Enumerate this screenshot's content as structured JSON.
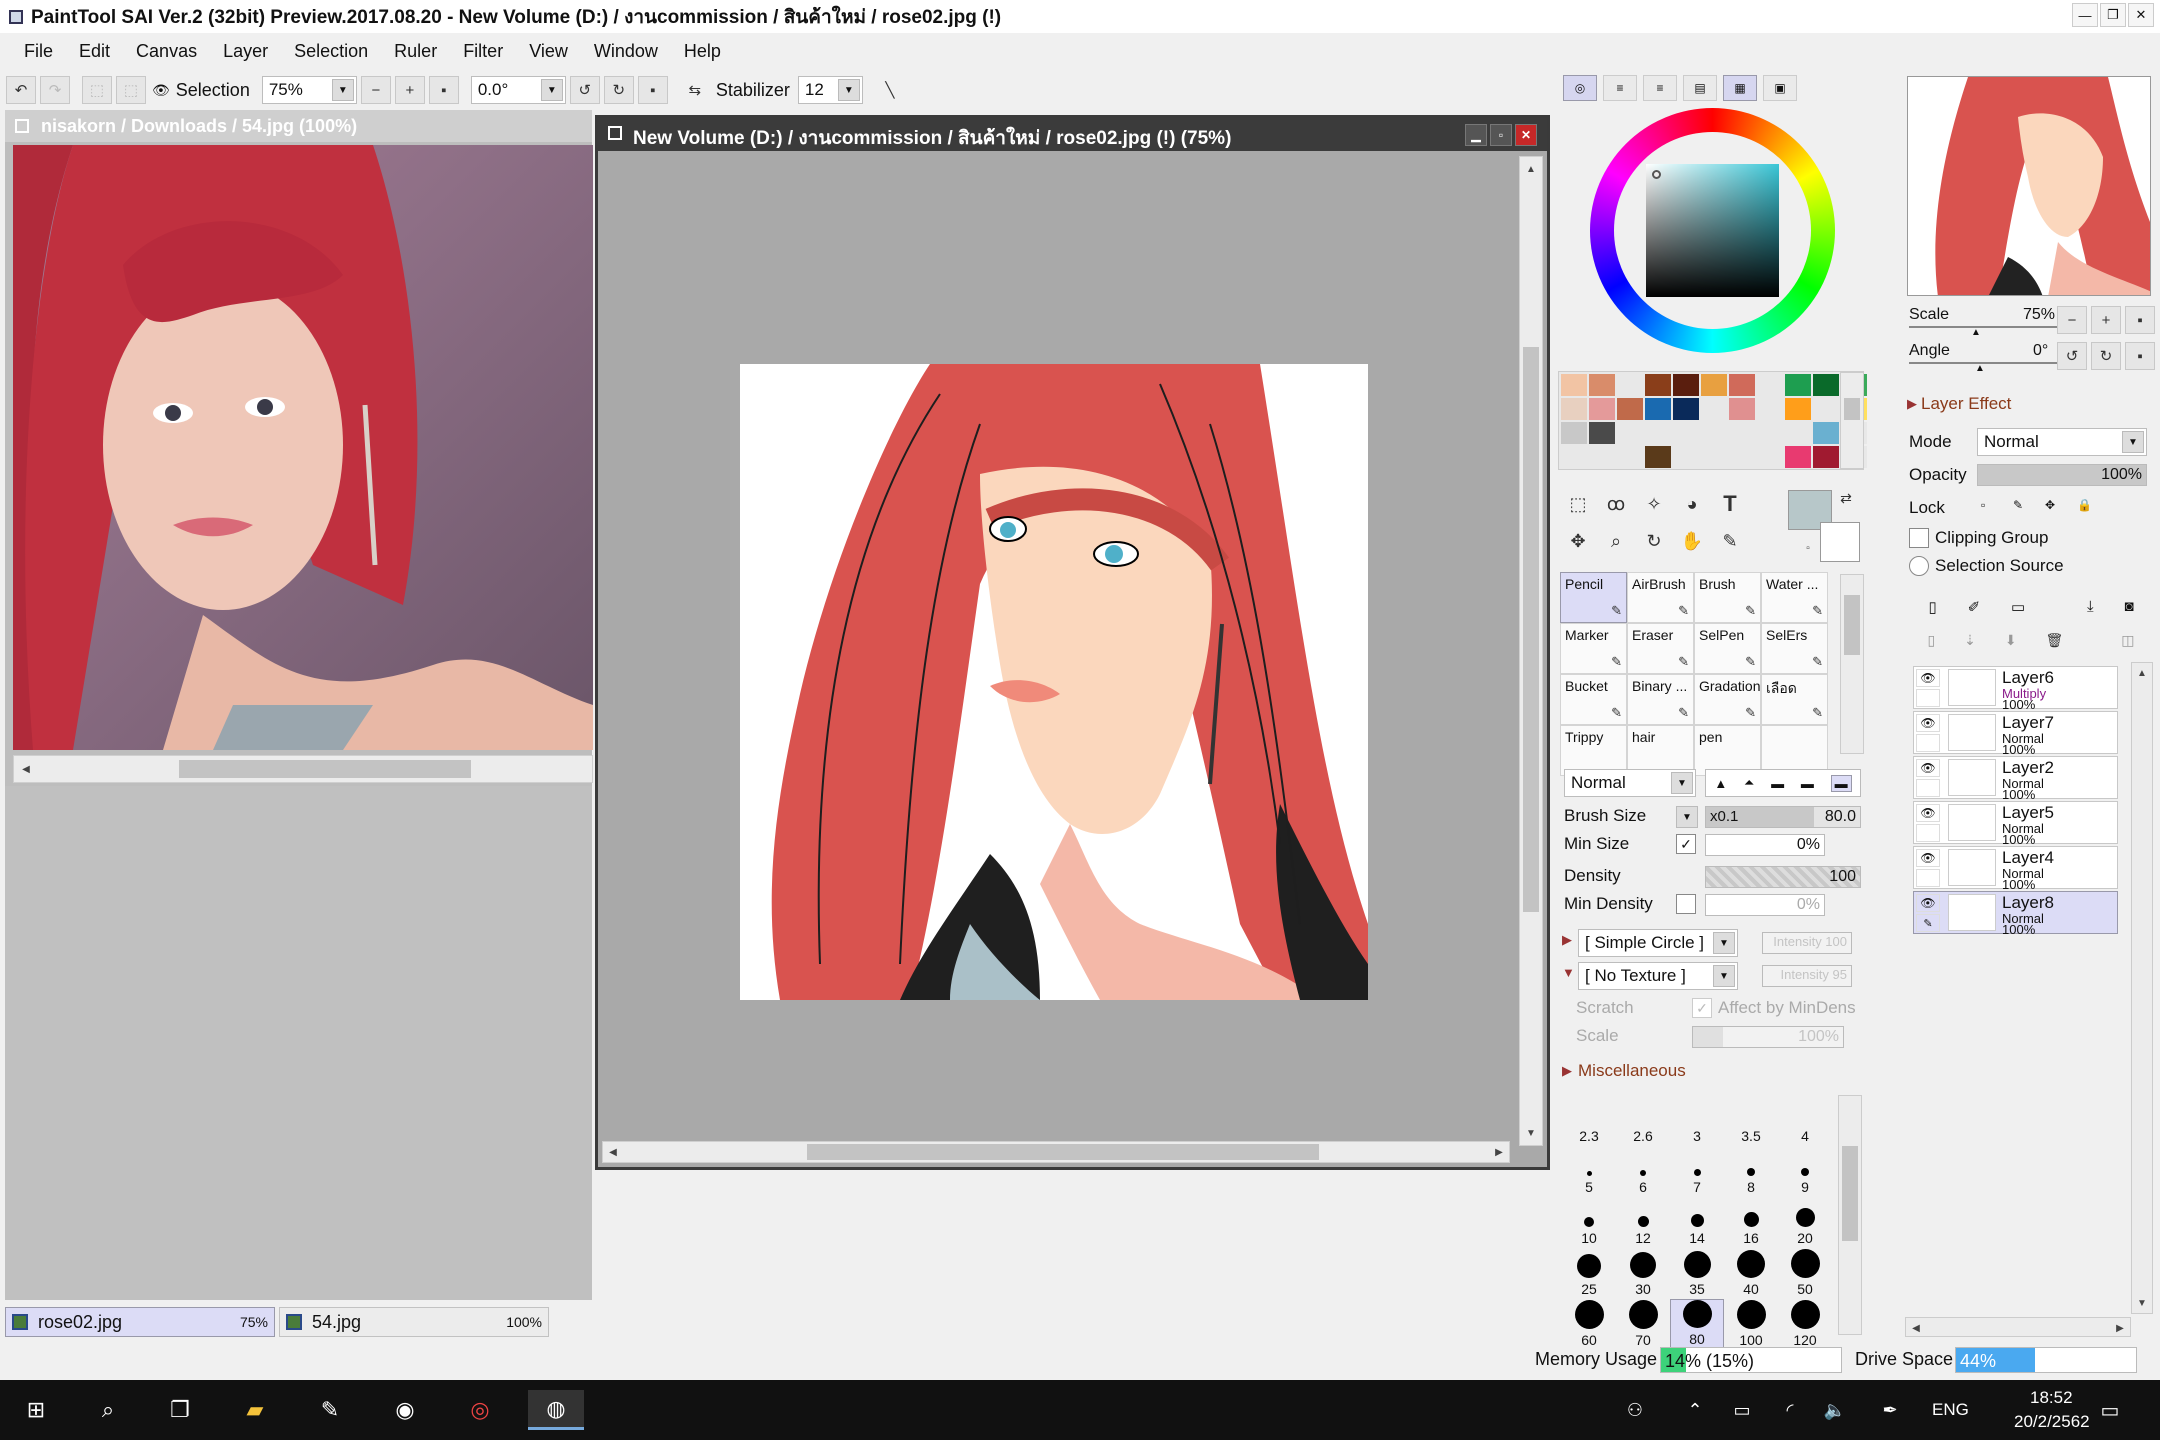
{
  "title_bar": {
    "title": "PaintTool SAI Ver.2 (32bit) Preview.2017.08.20 - New Volume (D:) / งานcommission / สินค้าใหม่ / rose02.jpg (!)"
  },
  "menu": [
    "File",
    "Edit",
    "Canvas",
    "Layer",
    "Selection",
    "Ruler",
    "Filter",
    "View",
    "Window",
    "Help"
  ],
  "toolbar": {
    "selection_label": "Selection",
    "zoom": "75%",
    "rotation": "0.0°",
    "stabilizer_label": "Stabilizer",
    "stabilizer_value": "12"
  },
  "ref_window": {
    "title": "nisakorn / Downloads / 54.jpg (100%)"
  },
  "canvas_window": {
    "title": "New Volume (D:) / งานcommission / สินค้าใหม่ / rose02.jpg (!) (75%)"
  },
  "file_tabs": [
    {
      "name": "rose02.jpg",
      "zoom": "75%",
      "selected": true
    },
    {
      "name": "54.jpg",
      "zoom": "100%",
      "selected": false
    }
  ],
  "swatch_colors": [
    "#f2c4a4",
    "#d98c6a",
    "#e8e8e8",
    "#8a3e1a",
    "#5a1e0e",
    "#e8a040",
    "#d06a5a",
    "#e8e8e8",
    "#1e9e50",
    "#0a6a2a",
    "#3aaa5a",
    "#e8d0c0",
    "#e49a9a",
    "#c06a4a",
    "#1a6ab0",
    "#0a2a5a",
    "#e8e8e8",
    "#e09090",
    "#e8e8e8",
    "#ff9e1a",
    "#e8e8e8",
    "#ffe060",
    "#c8c8c8",
    "#4a4a4a",
    "#e8e8e8",
    "#e8e8e8",
    "#e8e8e8",
    "#e8e8e8",
    "#e8e8e8",
    "#e8e8e8",
    "#e8e8e8",
    "#6ab0d0",
    "#e8e8e8",
    "#e8e8e8",
    "#e8e8e8",
    "#e8e8e8",
    "#5a3a1a",
    "#e8e8e8",
    "#e8e8e8",
    "#e8e8e8",
    "#e8e8e8",
    "#e83a70",
    "#a01a30",
    "#e8e8e8"
  ],
  "brush_tools": [
    {
      "name": "Pencil",
      "selected": true
    },
    {
      "name": "AirBrush"
    },
    {
      "name": "Brush"
    },
    {
      "name": "Water ..."
    },
    {
      "name": "Marker"
    },
    {
      "name": "Eraser"
    },
    {
      "name": "SelPen"
    },
    {
      "name": "SelErs"
    },
    {
      "name": "Bucket"
    },
    {
      "name": "Binary ..."
    },
    {
      "name": "Gradation"
    },
    {
      "name": "เลือด"
    },
    {
      "name": "Trippy"
    },
    {
      "name": "hair"
    },
    {
      "name": "pen"
    },
    {
      "name": ""
    }
  ],
  "brush": {
    "blend_mode": "Normal",
    "brush_size_label": "Brush Size",
    "brush_size_mult": "x0.1",
    "brush_size": "80.0",
    "min_size_label": "Min Size",
    "min_size": "0%",
    "density_label": "Density",
    "density": "100",
    "min_density_label": "Min Density",
    "min_density": "0%",
    "shape": "[ Simple Circle ]",
    "shape_intensity": "Intensity 100",
    "texture": "[ No Texture ]",
    "texture_intensity": "Intensity  95",
    "scratch_label": "Scratch",
    "affect_label": "Affect by MinDens",
    "scale_label": "Scale",
    "scale_value": "100%",
    "misc_label": "Miscellaneous"
  },
  "brush_sizes": [
    {
      "label": "2.3",
      "d": 0
    },
    {
      "label": "2.6",
      "d": 0
    },
    {
      "label": "3",
      "d": 0
    },
    {
      "label": "3.5",
      "d": 0
    },
    {
      "label": "4",
      "d": 0
    },
    {
      "label": "5",
      "d": 5
    },
    {
      "label": "6",
      "d": 6
    },
    {
      "label": "7",
      "d": 7
    },
    {
      "label": "8",
      "d": 8
    },
    {
      "label": "9",
      "d": 8
    },
    {
      "label": "10",
      "d": 10
    },
    {
      "label": "12",
      "d": 11
    },
    {
      "label": "14",
      "d": 13
    },
    {
      "label": "16",
      "d": 15
    },
    {
      "label": "20",
      "d": 19
    },
    {
      "label": "25",
      "d": 24
    },
    {
      "label": "30",
      "d": 26
    },
    {
      "label": "35",
      "d": 27
    },
    {
      "label": "40",
      "d": 28
    },
    {
      "label": "50",
      "d": 29
    },
    {
      "label": "60",
      "d": 29
    },
    {
      "label": "70",
      "d": 29
    },
    {
      "label": "80",
      "d": 29,
      "selected": true
    },
    {
      "label": "100",
      "d": 29
    },
    {
      "label": "120",
      "d": 29
    }
  ],
  "navigator": {
    "scale_label": "Scale",
    "scale": "75%",
    "angle_label": "Angle",
    "angle": "0°"
  },
  "layer_effect": {
    "title": "Layer Effect",
    "mode_label": "Mode",
    "mode": "Normal",
    "opacity_label": "Opacity",
    "opacity": "100%",
    "lock_label": "Lock",
    "clipping_group": "Clipping Group",
    "selection_source": "Selection Source"
  },
  "layers": [
    {
      "name": "Layer6",
      "mode": "Multiply",
      "opacity": "100%"
    },
    {
      "name": "Layer7",
      "mode": "Normal",
      "opacity": "100%"
    },
    {
      "name": "Layer2",
      "mode": "Normal",
      "opacity": "100%"
    },
    {
      "name": "Layer5",
      "mode": "Normal",
      "opacity": "100%"
    },
    {
      "name": "Layer4",
      "mode": "Normal",
      "opacity": "100%"
    },
    {
      "name": "Layer8",
      "mode": "Normal",
      "opacity": "100%",
      "selected": true
    }
  ],
  "status": {
    "memory_label": "Memory Usage",
    "memory": "14% (15%)",
    "memory_fraction": 0.14,
    "drive_label": "Drive Space",
    "drive": "44%",
    "drive_fraction": 0.44
  },
  "taskbar": {
    "lang": "ENG",
    "time": "18:52",
    "date": "20/2/2562"
  }
}
